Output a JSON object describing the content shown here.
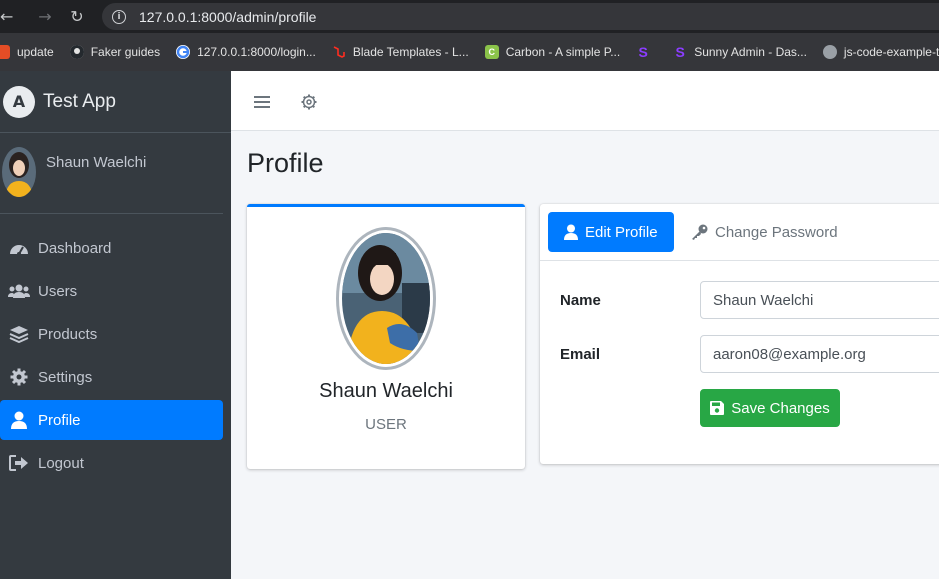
{
  "browser": {
    "url": "127.0.0.1:8000/admin/profile",
    "bookmarks": [
      {
        "label": "update",
        "icon": "bookmark-icon",
        "color": "#e44d26"
      },
      {
        "label": "Faker guides",
        "icon": "github-icon",
        "color": "#333333"
      },
      {
        "label": "127.0.0.1:8000/login...",
        "icon": "google-icon",
        "color": "#ffffff"
      },
      {
        "label": "Blade Templates - L...",
        "icon": "laravel-icon",
        "color": "#ff2d20"
      },
      {
        "label": "Carbon - A simple P...",
        "icon": "carbon-icon",
        "color": "#8bc34a"
      },
      {
        "label": "",
        "icon": "s-logo-icon",
        "color": "#8b3dff"
      },
      {
        "label": "Sunny Admin - Das...",
        "icon": "s-logo-icon",
        "color": "#8b3dff"
      },
      {
        "label": "js-code-example-te...",
        "icon": "globe-icon",
        "color": "#9aa0a6"
      }
    ]
  },
  "brand": {
    "logo_letter": "A",
    "name": "Test App"
  },
  "user": {
    "name": "Shaun Waelchi"
  },
  "sidebar": {
    "items": [
      {
        "label": "Dashboard",
        "icon": "tachometer-icon"
      },
      {
        "label": "Users",
        "icon": "users-icon"
      },
      {
        "label": "Products",
        "icon": "layers-icon"
      },
      {
        "label": "Settings",
        "icon": "gear-icon"
      },
      {
        "label": "Profile",
        "icon": "user-icon",
        "active": true
      },
      {
        "label": "Logout",
        "icon": "sign-out-icon"
      }
    ]
  },
  "page": {
    "title": "Profile"
  },
  "profile_card": {
    "name": "Shaun Waelchi",
    "role": "USER"
  },
  "form": {
    "tabs": {
      "edit": "Edit Profile",
      "password": "Change Password"
    },
    "name_label": "Name",
    "name_value": "Shaun Waelchi",
    "email_label": "Email",
    "email_value": "aaron08@example.org",
    "save_label": "Save Changes"
  },
  "colors": {
    "primary": "#007bff",
    "success": "#28a745",
    "sidebar": "#343a40"
  }
}
